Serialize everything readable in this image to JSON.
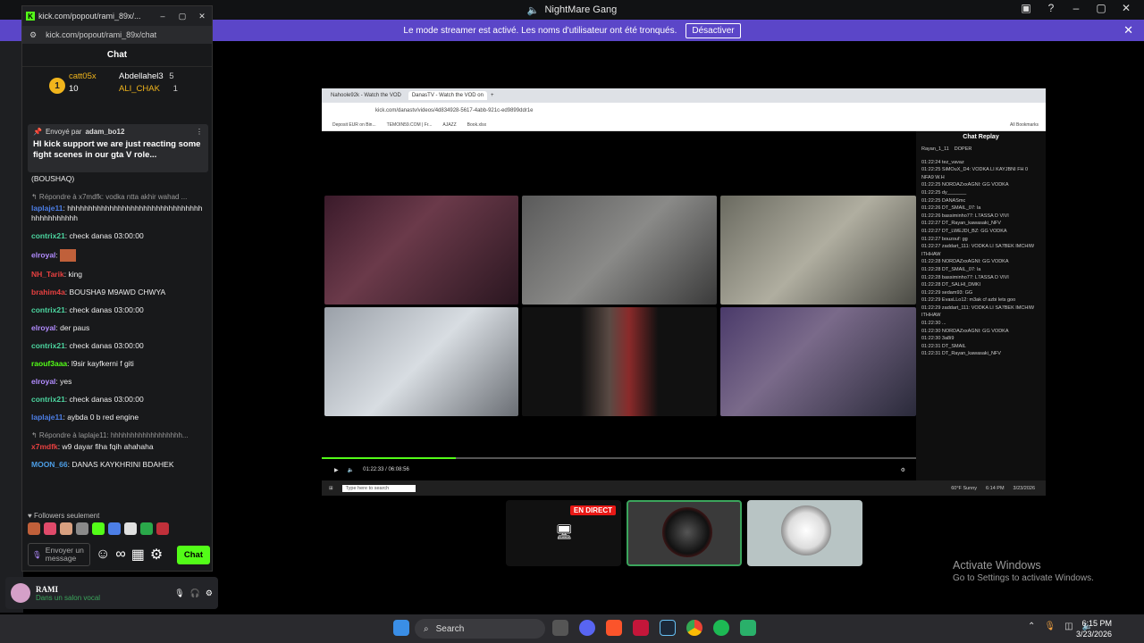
{
  "app": {
    "window_title": "NightMare Gang",
    "notice": "Le mode streamer est activé. Les noms d'utilisateur ont été tronqués.",
    "notice_button": "Désactiver"
  },
  "popout": {
    "window_title": "kick.com/popout/rami_89x/...",
    "url": "kick.com/popout/rami_89x/chat",
    "chat_title": "Chat",
    "leaderboard": [
      {
        "name": "catt05x",
        "count": "10",
        "rank": "1"
      },
      {
        "name": "Abdellahel3",
        "count": "5"
      },
      {
        "name": "ALI_CHAK",
        "count": "1"
      }
    ],
    "pinned": {
      "meta": "Envoyé par",
      "author": "adam_bo12",
      "text": "HI kick support we are just reacting some fight scenes in our gta V role..."
    },
    "messages": [
      {
        "text": "(BOUSHAQ)"
      },
      {
        "reply": "↰ Répondre à x7mdfk: vodka ntta akhir wahad ...",
        "user": "laplaje11",
        "color": "#4c7ee6",
        "text": "hhhhhhhhhhhhhhhhhhhhhhhhhhhhhhhhhhhhhhhhhhh"
      },
      {
        "user": "contrix21",
        "color": "#4cd6a0",
        "text": "check danas 03:00:00"
      },
      {
        "user": "elroyal",
        "color": "#b28cff",
        "text": ""
      },
      {
        "user": "NH_Tarik",
        "color": "#e64040",
        "text": "king"
      },
      {
        "user": "brahim4a",
        "color": "#e64040",
        "text": "BOUSHA9 M9AWD CHWYA"
      },
      {
        "user": "contrix21",
        "color": "#4cd6a0",
        "text": "check danas 03:00:00"
      },
      {
        "user": "elroyal",
        "color": "#b28cff",
        "text": "der paus"
      },
      {
        "user": "contrix21",
        "color": "#4cd6a0",
        "text": "check danas 03:00:00"
      },
      {
        "user": "raouf3aaa",
        "color": "#53fc18",
        "text": "l9sir kayfkerni f giti"
      },
      {
        "user": "elroyal",
        "color": "#b28cff",
        "text": "yes"
      },
      {
        "user": "contrix21",
        "color": "#4cd6a0",
        "text": "check danas 03:00:00"
      },
      {
        "user": "laplaje11",
        "color": "#4c7ee6",
        "text": "aybda 0 b red engine"
      },
      {
        "reply": "↰ Répondre à laplaje11: hhhhhhhhhhhhhhhhhh...",
        "user": "x7mdfk",
        "color": "#e64040",
        "text": "w9 dayar fiha fqih ahahaha"
      },
      {
        "user": "MOON_66",
        "color": "#4c9ee6",
        "text": "DANAS KAYKHRINI BDAHEK"
      }
    ],
    "followers": "Followers seulement",
    "input_placeholder": "Envoyer un message",
    "chat_button": "Chat"
  },
  "voice": {
    "user": "RAMI",
    "status": "Dans un salon vocal"
  },
  "stream": {
    "tab1": "Nahoole92k - Watch the VOD",
    "tab2": "DanasTV - Watch the VOD on",
    "address": "kick.com/danastv/videos/4d834928-5617-4abb-921c-ed9899ddr1e",
    "bookmarks": [
      "Deposit EUR on Bin...",
      "TEMOIN59.COM | Fr...",
      "AJAZZ",
      "Book.xlsx"
    ],
    "all_bookmarks": "All Bookmarks",
    "time": "01:22:33 / 06:08:56",
    "replay_title": "Chat Replay",
    "replay_top": "Rayan_1_11",
    "replay_gift": "DOPER",
    "replay_lines": [
      "01:22:24 tez_vavaz",
      "01:22:25 SiMOuX_D4: VODKA LI KAYJBNI FH 0 NFA9 W.H",
      "01:22:25 NORDAZxxAGNI: GG VODKA",
      "01:22:25 dy_______",
      "01:22:25 DANASmc",
      "01:22:26 DT_SMAIL_07: la",
      "01:22:26 bassiminho77: L7ASSA D VIVI",
      "01:22:27 DT_Rayan_kawasaki_NFV",
      "01:22:27 DT_LWEJDI_BZ: GG VODKA",
      "01:22:27 bouzouf: gg",
      "01:22:27 zaddart_111: VODKA LI SA7BEK IMCHIW ITHHAW",
      "01:22:28 NORDAZxxAGNI: GG VODKA",
      "01:22:28 DT_SMAIL_07: la",
      "01:22:28 bassiminho77: L7ASSA D VIVI",
      "01:22:28 DT_SALHI_DMKI",
      "01:22:29 sedam93: GG",
      "01:22:29 EvasLLo12: m3ak cf azbi lets goo",
      "01:22:29 zaddart_111: VODKA LI SA7BEK IMCHIW ITHHAW",
      "01:22:30 ...",
      "01:22:30 NORDAZxxAGNI: GG VODKA",
      "01:22:30 3a8i9",
      "01:22:31 DT_SMAIL",
      "01:22:31 DT_Rayan_kawasaki_NFV"
    ],
    "taskbar_search": "Type here to search",
    "taskbar_weather": "60°F Sunny",
    "taskbar_time": "6:14 PM",
    "taskbar_date": "3/23/2026"
  },
  "participants": {
    "live_badge": "EN DIRECT"
  },
  "activate": {
    "line1": "Activate Windows",
    "line2": "Go to Settings to activate Windows."
  },
  "taskbar": {
    "search": "Search",
    "time": "6:15 PM",
    "date": "3/23/2026"
  }
}
